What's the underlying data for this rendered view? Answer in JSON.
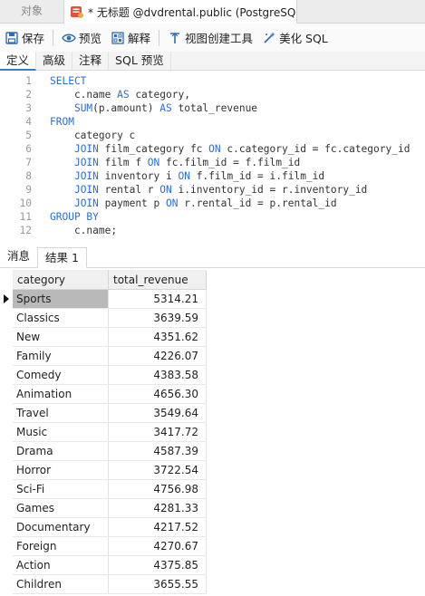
{
  "tabs": {
    "objects_label": "对象",
    "query_label": "* 无标题 @dvdrental.public (PostgreSQ..."
  },
  "toolbar": {
    "save_label": "保存",
    "preview_label": "预览",
    "explain_label": "解释",
    "view_builder_label": "视图创建工具",
    "beautify_label": "美化 SQL"
  },
  "editor_tabs": [
    "定义",
    "高级",
    "注释",
    "SQL 预览"
  ],
  "code_lines": [
    {
      "n": "1",
      "segs": [
        {
          "t": "SELECT",
          "k": true
        }
      ]
    },
    {
      "n": "2",
      "segs": [
        {
          "t": "    c.name ",
          "k": false
        },
        {
          "t": "AS",
          "k": true
        },
        {
          "t": " category,",
          "k": false
        }
      ]
    },
    {
      "n": "3",
      "segs": [
        {
          "t": "    ",
          "k": false
        },
        {
          "t": "SUM",
          "k": true
        },
        {
          "t": "(p.amount) ",
          "k": false
        },
        {
          "t": "AS",
          "k": true
        },
        {
          "t": " total_revenue",
          "k": false
        }
      ]
    },
    {
      "n": "4",
      "segs": [
        {
          "t": "FROM",
          "k": true
        }
      ]
    },
    {
      "n": "5",
      "segs": [
        {
          "t": "    category c",
          "k": false
        }
      ]
    },
    {
      "n": "6",
      "segs": [
        {
          "t": "    ",
          "k": false
        },
        {
          "t": "JOIN",
          "k": true
        },
        {
          "t": " film_category fc ",
          "k": false
        },
        {
          "t": "ON",
          "k": true
        },
        {
          "t": " c.category_id = fc.category_id",
          "k": false
        }
      ]
    },
    {
      "n": "7",
      "segs": [
        {
          "t": "    ",
          "k": false
        },
        {
          "t": "JOIN",
          "k": true
        },
        {
          "t": " film f ",
          "k": false
        },
        {
          "t": "ON",
          "k": true
        },
        {
          "t": " fc.film_id = f.film_id",
          "k": false
        }
      ]
    },
    {
      "n": "8",
      "segs": [
        {
          "t": "    ",
          "k": false
        },
        {
          "t": "JOIN",
          "k": true
        },
        {
          "t": " inventory i ",
          "k": false
        },
        {
          "t": "ON",
          "k": true
        },
        {
          "t": " f.film_id = i.film_id",
          "k": false
        }
      ]
    },
    {
      "n": "9",
      "segs": [
        {
          "t": "    ",
          "k": false
        },
        {
          "t": "JOIN",
          "k": true
        },
        {
          "t": " rental r ",
          "k": false
        },
        {
          "t": "ON",
          "k": true
        },
        {
          "t": " i.inventory_id = r.inventory_id",
          "k": false
        }
      ]
    },
    {
      "n": "10",
      "segs": [
        {
          "t": "    ",
          "k": false
        },
        {
          "t": "JOIN",
          "k": true
        },
        {
          "t": " payment p ",
          "k": false
        },
        {
          "t": "ON",
          "k": true
        },
        {
          "t": " r.rental_id = p.rental_id",
          "k": false
        }
      ]
    },
    {
      "n": "11",
      "segs": [
        {
          "t": "GROUP BY",
          "k": true
        }
      ]
    },
    {
      "n": "12",
      "segs": [
        {
          "t": "    c.name;",
          "k": false
        }
      ]
    }
  ],
  "result_tabs": [
    "消息",
    "结果 1"
  ],
  "result": {
    "columns": [
      "category",
      "total_revenue"
    ],
    "selected_row": 0,
    "rows": [
      [
        "Sports",
        "5314.21"
      ],
      [
        "Classics",
        "3639.59"
      ],
      [
        "New",
        "4351.62"
      ],
      [
        "Family",
        "4226.07"
      ],
      [
        "Comedy",
        "4383.58"
      ],
      [
        "Animation",
        "4656.30"
      ],
      [
        "Travel",
        "3549.64"
      ],
      [
        "Music",
        "3417.72"
      ],
      [
        "Drama",
        "4587.39"
      ],
      [
        "Horror",
        "3722.54"
      ],
      [
        "Sci-Fi",
        "4756.98"
      ],
      [
        "Games",
        "4281.33"
      ],
      [
        "Documentary",
        "4217.52"
      ],
      [
        "Foreign",
        "4270.67"
      ],
      [
        "Action",
        "4375.85"
      ],
      [
        "Children",
        "3655.55"
      ]
    ]
  }
}
